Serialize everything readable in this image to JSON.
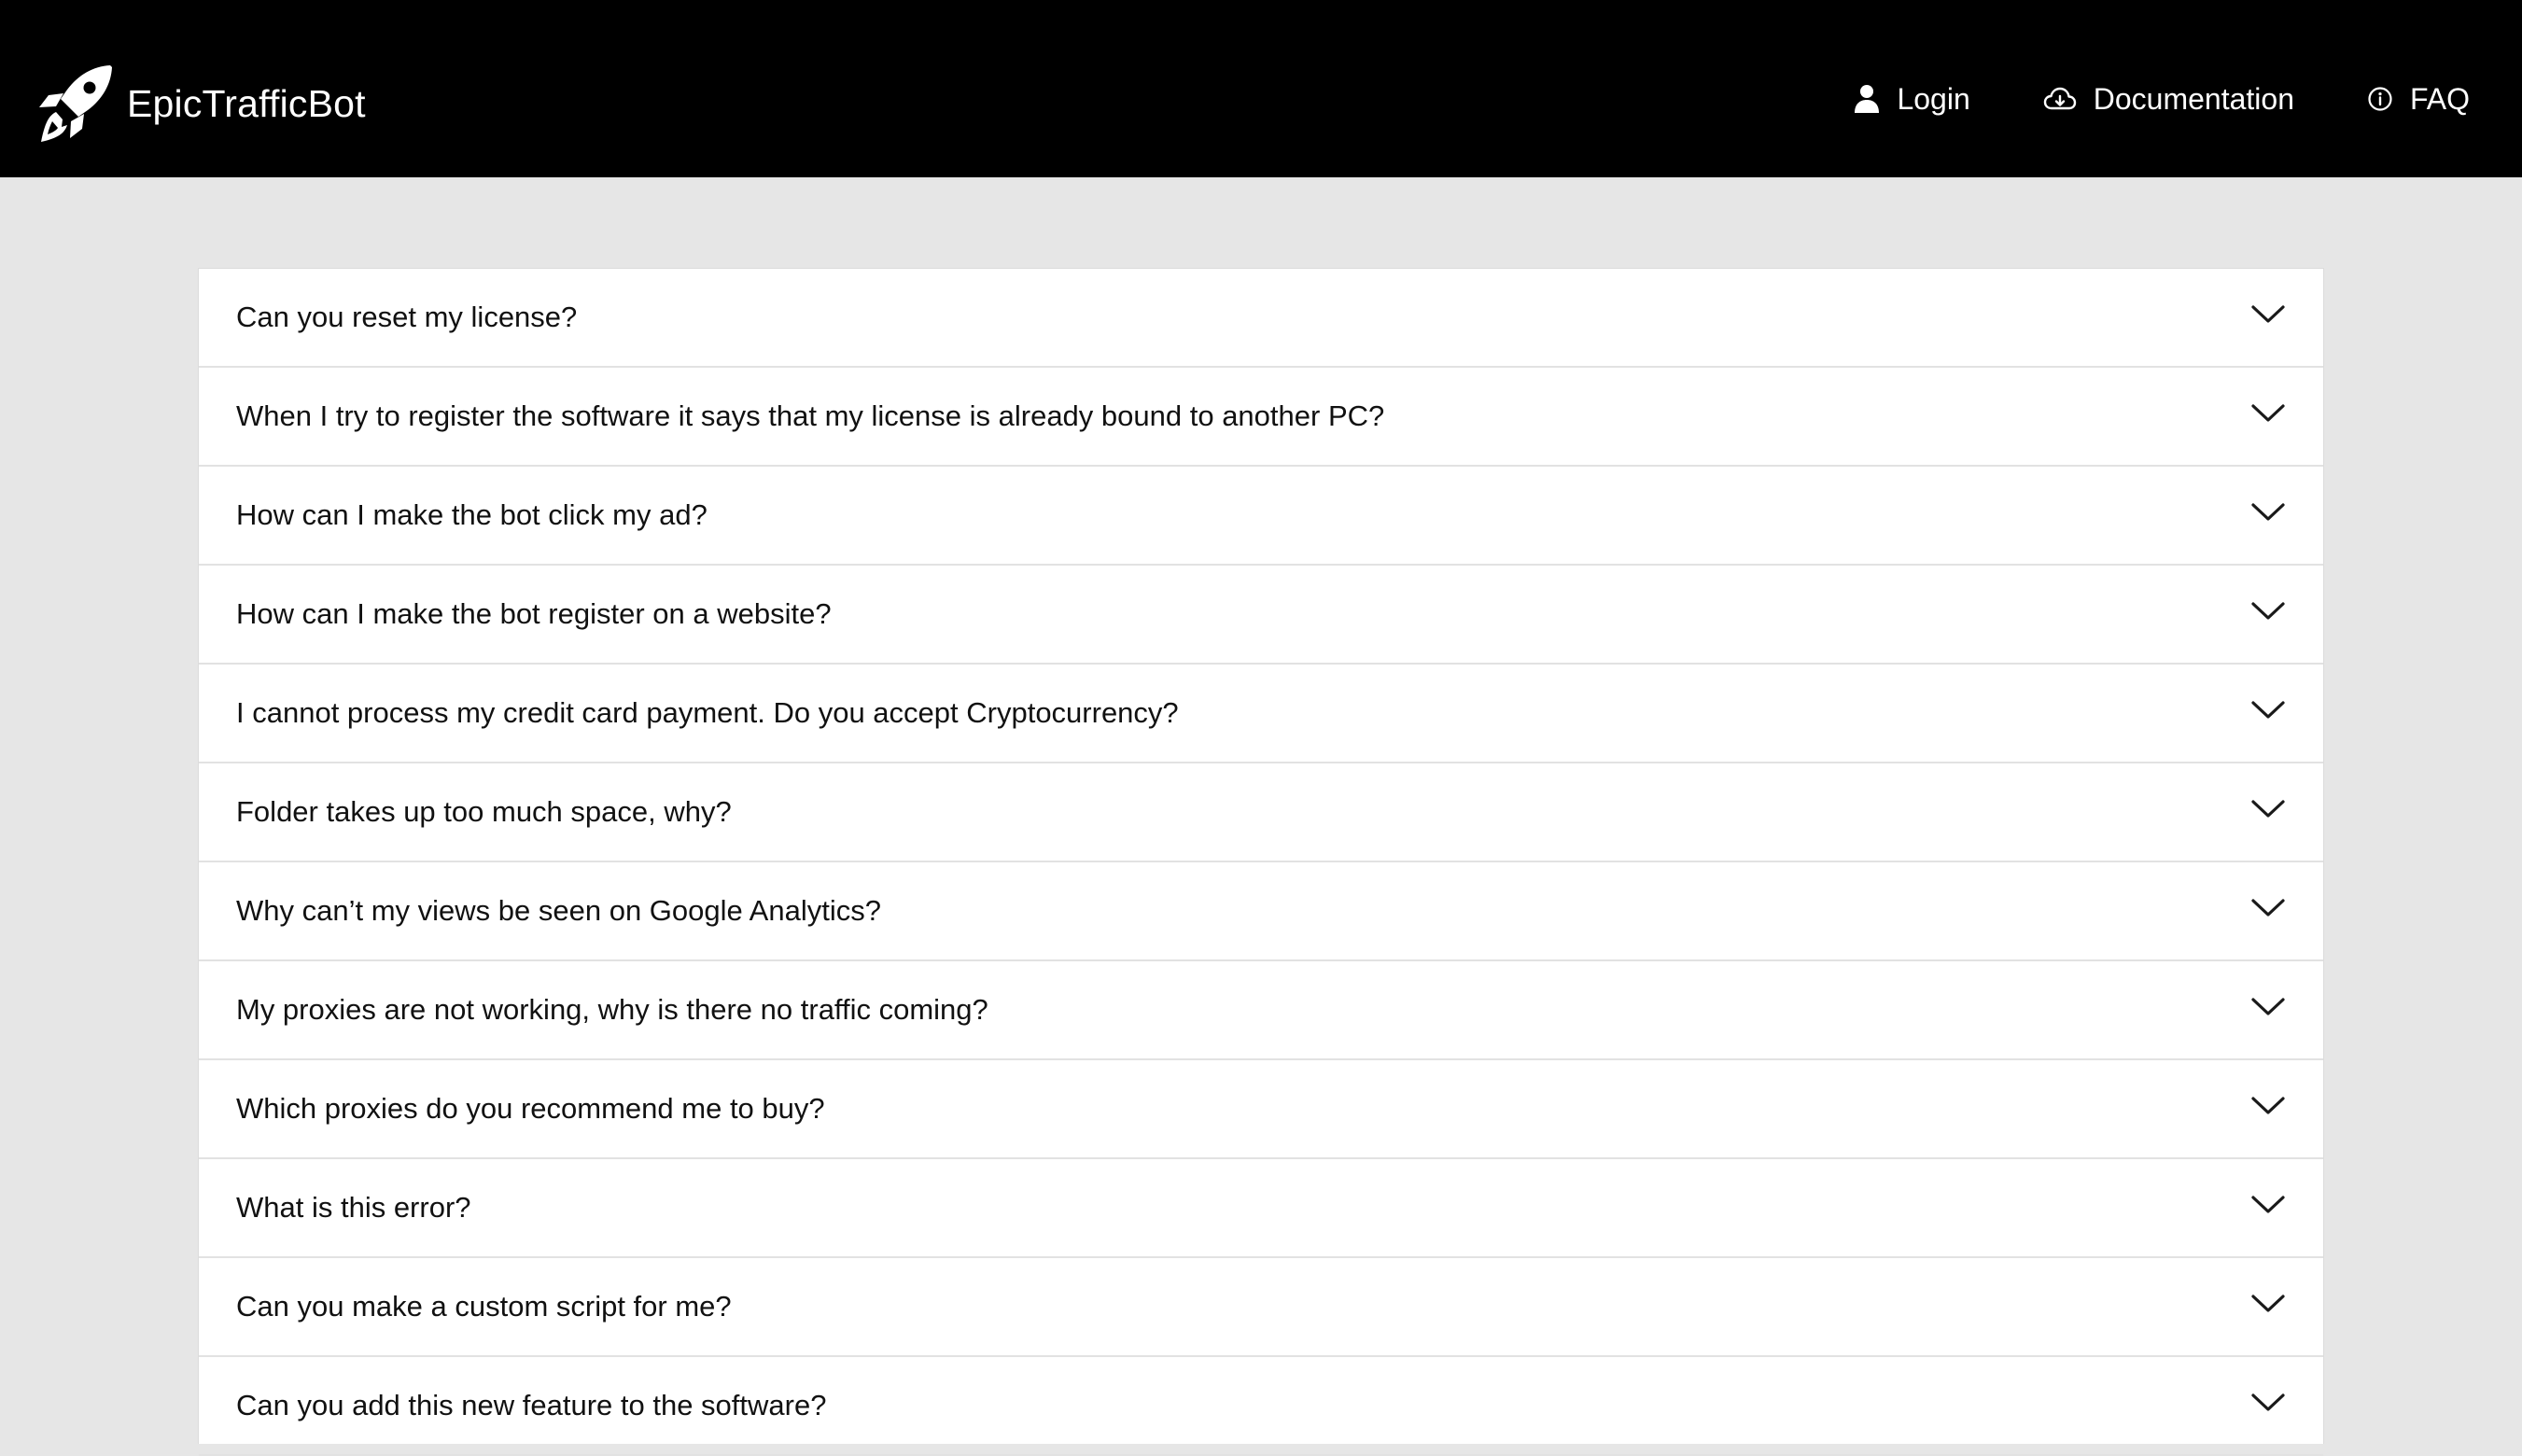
{
  "header": {
    "brand_name": "EpicTrafficBot",
    "logo_icon": "rocket-icon",
    "nav": [
      {
        "label": "Login",
        "icon": "user-icon"
      },
      {
        "label": "Documentation",
        "icon": "cloud-download-icon"
      },
      {
        "label": "FAQ",
        "icon": "info-circle-icon"
      }
    ]
  },
  "faq": {
    "items": [
      {
        "question": "Can you reset my license?"
      },
      {
        "question": "When I try to register the software it says that my license is already bound to another PC?"
      },
      {
        "question": "How can I make the bot click my ad?"
      },
      {
        "question": "How can I make the bot register on a website?"
      },
      {
        "question": "I cannot process my credit card payment. Do you accept Cryptocurrency?"
      },
      {
        "question": "Folder takes up too much space, why?"
      },
      {
        "question": "Why can’t my views be seen on Google Analytics?"
      },
      {
        "question": "My proxies are not working, why is there no traffic coming?"
      },
      {
        "question": "Which proxies do you recommend me to buy?"
      },
      {
        "question": "What is this error?"
      },
      {
        "question": "Can you make a custom script for me?"
      },
      {
        "question": "Can you add this new feature to the software?"
      }
    ]
  },
  "colors": {
    "header_bg": "#000000",
    "page_bg": "#e6e6e6",
    "panel_bg": "#ffffff",
    "text": "#111111"
  }
}
